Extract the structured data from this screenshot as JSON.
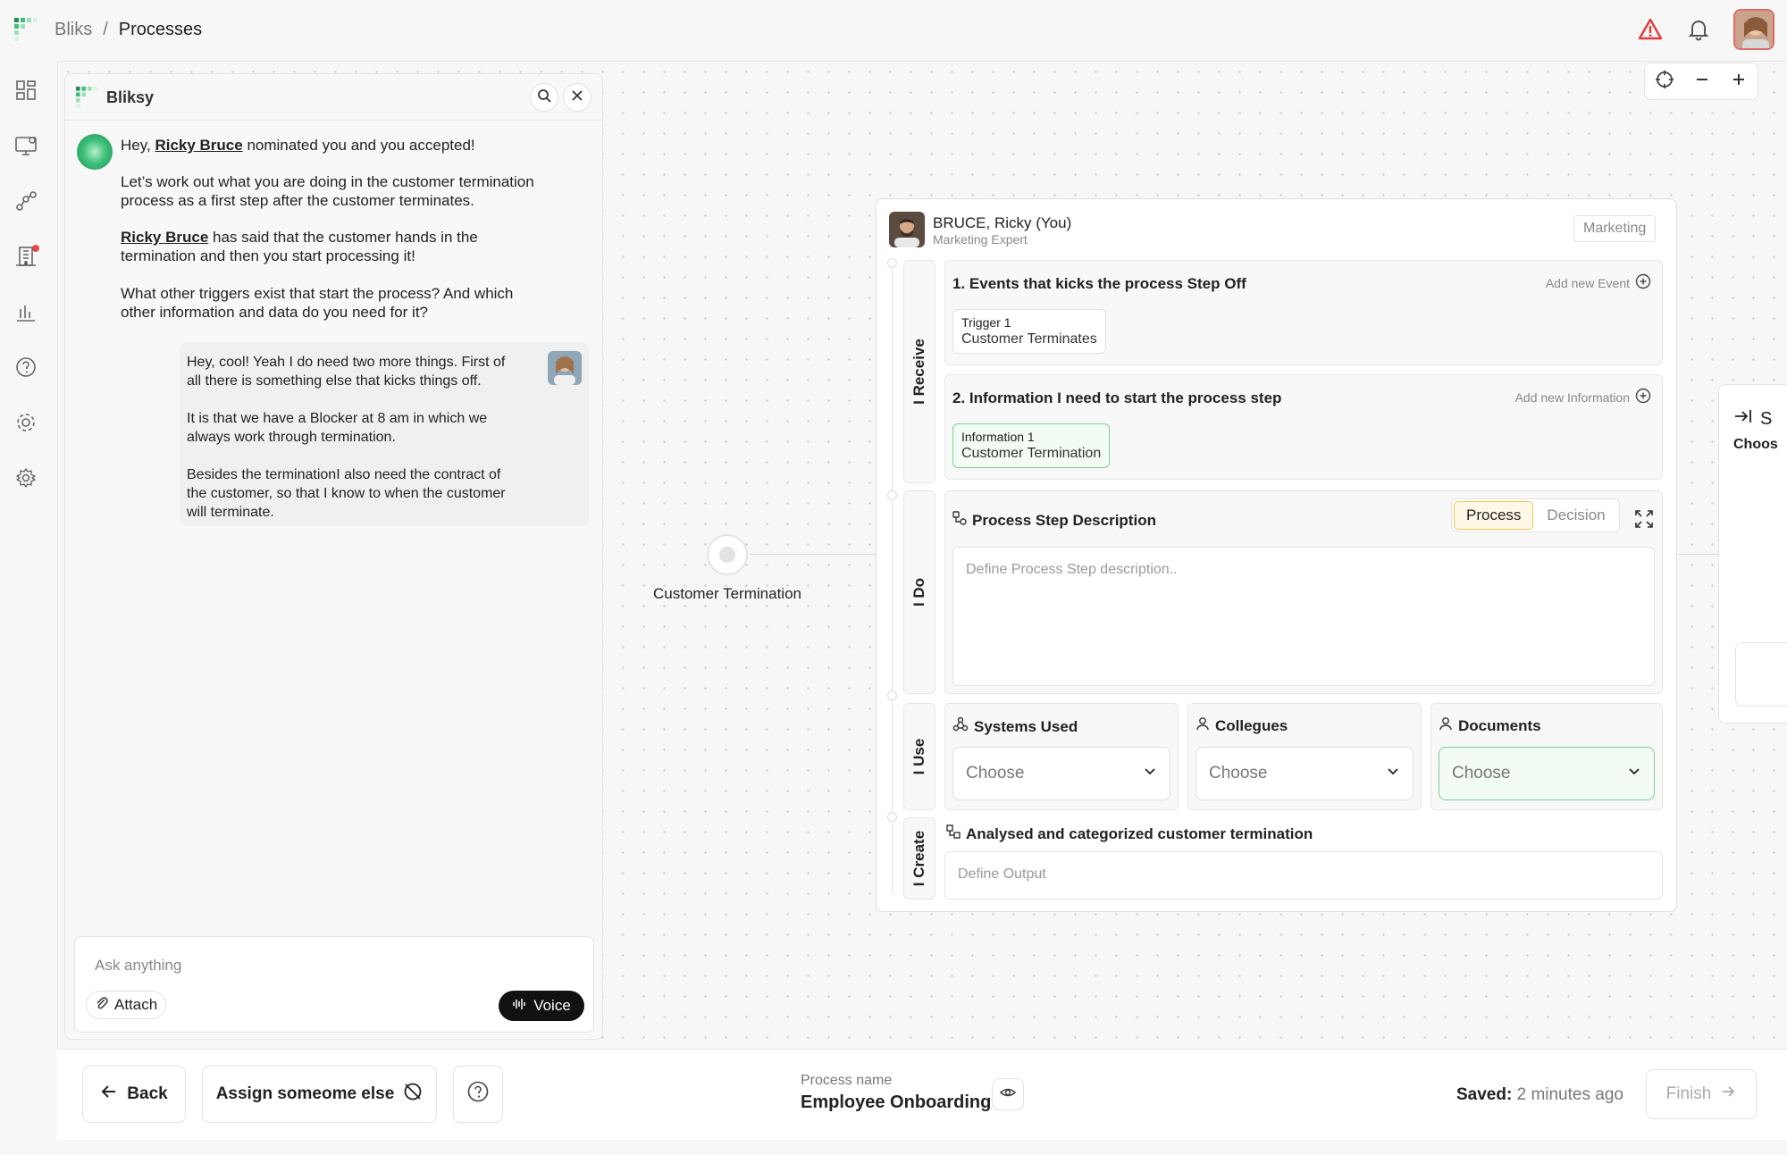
{
  "breadcrumb": {
    "root": "Bliks",
    "separator": "/",
    "current": "Processes"
  },
  "chat": {
    "title": "Bliksy",
    "bot_messages": {
      "m1_pre": "Hey,",
      "m1_name": "Ricky Bruce",
      "m1_post": "nominated you and you accepted!",
      "m2_l1": "Let’s work out what you are doing in the customer termination",
      "m2_l2": "process as a first step after the customer terminates.",
      "m3_name": "Ricky Bruce",
      "m3_l1": "has said that the customer hands in the",
      "m3_l2": "termination and then you start processing it!",
      "m4_l1": "What other triggers exist that start the process? And which",
      "m4_l2": "other information and data do you need for it?"
    },
    "user_message": {
      "p1_l1": "Hey, cool! Yeah I do need two more things. First of",
      "p1_l2": "all there is something else that kicks things off.",
      "p2_l1": "It is that we have a Blocker at 8 am in which we",
      "p2_l2": "always work through termination.",
      "p3_l1": "Besides the terminationI also need the contract of",
      "p3_l2": "the customer, so that I know to when the customer",
      "p3_l3": "will terminate."
    },
    "input_placeholder": "Ask anything",
    "attach_label": "Attach",
    "voice_label": "Voice"
  },
  "node": {
    "label": "Customer Termination"
  },
  "card": {
    "name": "BRUCE, Ricky (You)",
    "role": "Marketing Expert",
    "tag": "Marketing",
    "sections": {
      "receive": "I Receive",
      "do": "I Do",
      "use": "I Use",
      "create": "I Create"
    },
    "events": {
      "title": "1. Events that kicks the process Step Off",
      "add": "Add new Event",
      "chip_key": "Trigger 1",
      "chip_value": "Customer Terminates"
    },
    "information": {
      "title": "2. Information I need to start the process step",
      "add": "Add new Information",
      "chip_key": "Information 1",
      "chip_value": "Customer Termination"
    },
    "description": {
      "title": "Process Step Description",
      "toggle_process": "Process",
      "toggle_decision": "Decision",
      "placeholder": "Define Process Step description.."
    },
    "use": {
      "systems_title": "Systems Used",
      "colleagues_title": "Collegues",
      "documents_title": "Documents",
      "choose": "Choose"
    },
    "create": {
      "title": "Analysed and categorized customer termination",
      "placeholder": "Define Output"
    }
  },
  "side_panel": {
    "title_partial": "S",
    "subtitle_partial": "Choos"
  },
  "bottom": {
    "back": "Back",
    "assign": "Assign someome else",
    "process_name_label": "Process name",
    "process_name": "Employee Onboarding",
    "saved_label": "Saved:",
    "saved_value": "2 minutes ago",
    "finish": "Finish"
  },
  "colors": {
    "accent_green": "#3ec27a",
    "alert_red": "#e03a3a",
    "toggle_yellow": "#f0c94a"
  },
  "icons": [
    "grid-logo",
    "alert-icon",
    "bell-icon",
    "dashboard-icon",
    "monitor-icon",
    "flow-icon",
    "building-icon",
    "chart-icon",
    "help-icon",
    "gear-icon",
    "settings-icon",
    "search-icon",
    "close-icon",
    "locate-icon",
    "minus-icon",
    "plus-icon",
    "paperclip-icon",
    "waveform-icon",
    "chevron-down-icon",
    "plus-circle-icon",
    "expand-icon",
    "eye-icon",
    "arrow-left-icon",
    "arrow-right-icon"
  ]
}
